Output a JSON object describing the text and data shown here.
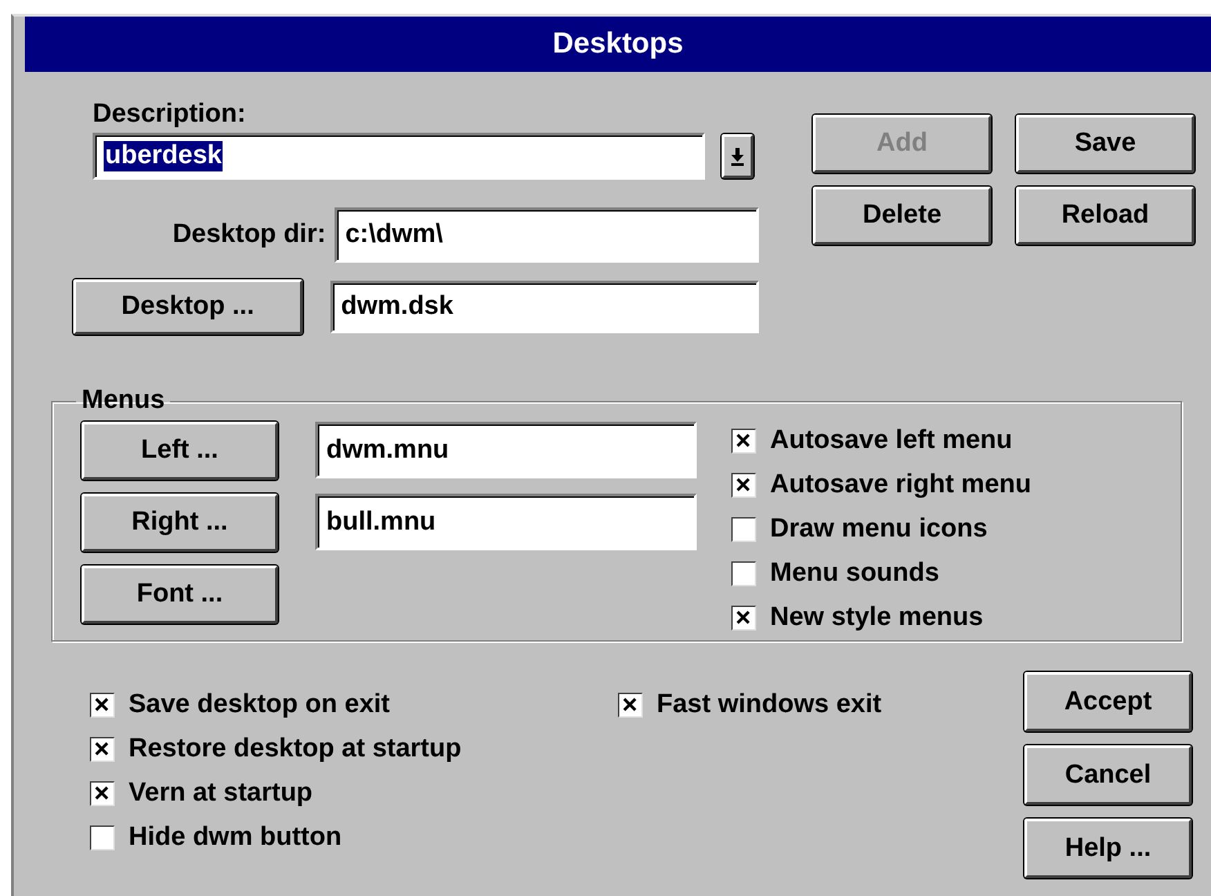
{
  "window": {
    "title": "Desktops"
  },
  "description": {
    "label": "Description:",
    "value": "uberdesk",
    "selected": true
  },
  "desktop_dir": {
    "label": "Desktop dir:",
    "value": "c:\\dwm\\"
  },
  "desktop_file": {
    "button": "Desktop ...",
    "value": "dwm.dsk"
  },
  "top_buttons": [
    {
      "label": "Add",
      "disabled": true
    },
    {
      "label": "Save",
      "disabled": false
    },
    {
      "label": "Delete",
      "disabled": false
    },
    {
      "label": "Reload",
      "disabled": false
    }
  ],
  "menus": {
    "title": "Menus",
    "rows": [
      {
        "button": "Left ...",
        "value": "dwm.mnu"
      },
      {
        "button": "Right ...",
        "value": "bull.mnu"
      },
      {
        "button": "Font ..."
      }
    ],
    "options": [
      {
        "label": "Autosave left menu",
        "checked": true
      },
      {
        "label": "Autosave right menu",
        "checked": true
      },
      {
        "label": "Draw menu icons",
        "checked": false
      },
      {
        "label": "Menu sounds",
        "checked": false
      },
      {
        "label": "New style menus",
        "checked": true
      }
    ]
  },
  "options_left": [
    {
      "label": "Save desktop on exit",
      "checked": true
    },
    {
      "label": "Restore desktop at startup",
      "checked": true
    },
    {
      "label": "Vern at startup",
      "checked": true
    },
    {
      "label": "Hide dwm button",
      "checked": false
    }
  ],
  "options_right": [
    {
      "label": "Fast windows exit",
      "checked": true
    }
  ],
  "dialog_buttons": [
    "Accept",
    "Cancel",
    "Help ..."
  ]
}
